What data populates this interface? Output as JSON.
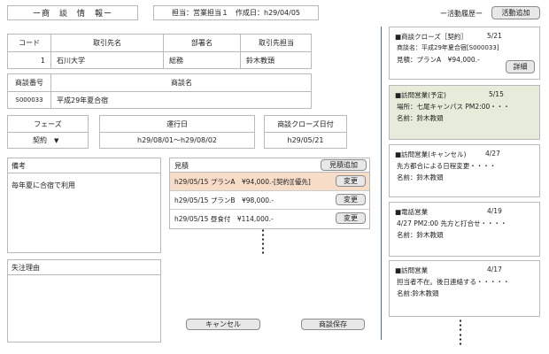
{
  "header": {
    "title": "ー商　談　情　報ー",
    "meta": "担当：営業担当１　作成日：h29/04/05"
  },
  "customer_table": {
    "headers": [
      "コード",
      "取引先名",
      "部署名",
      "取引先担当"
    ],
    "row": [
      "1",
      "石川大学",
      "総務",
      "鈴木教頭"
    ]
  },
  "deal_table": {
    "headers": [
      "商談番号",
      "商談名"
    ],
    "row": [
      "S000033",
      "平成29年夏合宿"
    ]
  },
  "phase": {
    "label": "フェーズ",
    "value": "契約",
    "arrow": "▼"
  },
  "run_date": {
    "label": "運行日",
    "value": "h29/08/01～h29/08/02"
  },
  "close_date": {
    "label": "商談クローズ日付",
    "value": "h29/05/21"
  },
  "remarks": {
    "label": "備考",
    "text": "毎年夏に合宿で利用"
  },
  "lost_reason": {
    "label": "失注理由",
    "text": ""
  },
  "estimates": {
    "label": "見積",
    "add_button": "見積追加",
    "rows": [
      {
        "text": "h29/05/15 プランA　¥94,000.-[契約][優先]",
        "button": "変更",
        "highlight": true
      },
      {
        "text": "h29/05/15 プランB　¥98,000.-",
        "button": "変更",
        "highlight": false
      },
      {
        "text": "h29/05/15 昼食付　¥114,000.-",
        "button": "変更",
        "highlight": false
      }
    ]
  },
  "buttons": {
    "cancel": "キャンセル",
    "save": "商談保存"
  },
  "history": {
    "title": "ー活動履歴ー",
    "add_button": "活動追加",
    "cards": [
      {
        "title": "■商談クローズ［契約］",
        "date": "5/21",
        "lines": [
          "商談名：平成29年夏合宿[S000033]",
          "見積：プランA　¥94,000.-"
        ],
        "detail_button": "詳細",
        "highlight": false
      },
      {
        "title": "■訪問営業(予定)",
        "date": "5/15",
        "lines": [
          "場所：七尾キャンパス PM2:00・・・",
          "名前：鈴木教頭"
        ],
        "highlight": true
      },
      {
        "title": "■訪問営業(キャンセル)",
        "date": "4/27",
        "lines": [
          "先方都合による日程変更・・・・",
          "名前：鈴木教頭"
        ],
        "highlight": false
      },
      {
        "title": "■電話営業",
        "date": "4/19",
        "lines": [
          "4/27 PM2:00 先方と打合せ・・・・",
          "名前：鈴木教頭"
        ],
        "highlight": false
      },
      {
        "title": "■訪問営業",
        "date": "4/17",
        "lines": [
          "担当者不在。後日連絡する・・・・・",
          "名前:鈴木教頭"
        ],
        "highlight": false
      }
    ]
  },
  "colors": {
    "highlight_row": "#f7dcc8",
    "highlight_card": "#e6ecd9",
    "divider": "#4a6aa0"
  }
}
